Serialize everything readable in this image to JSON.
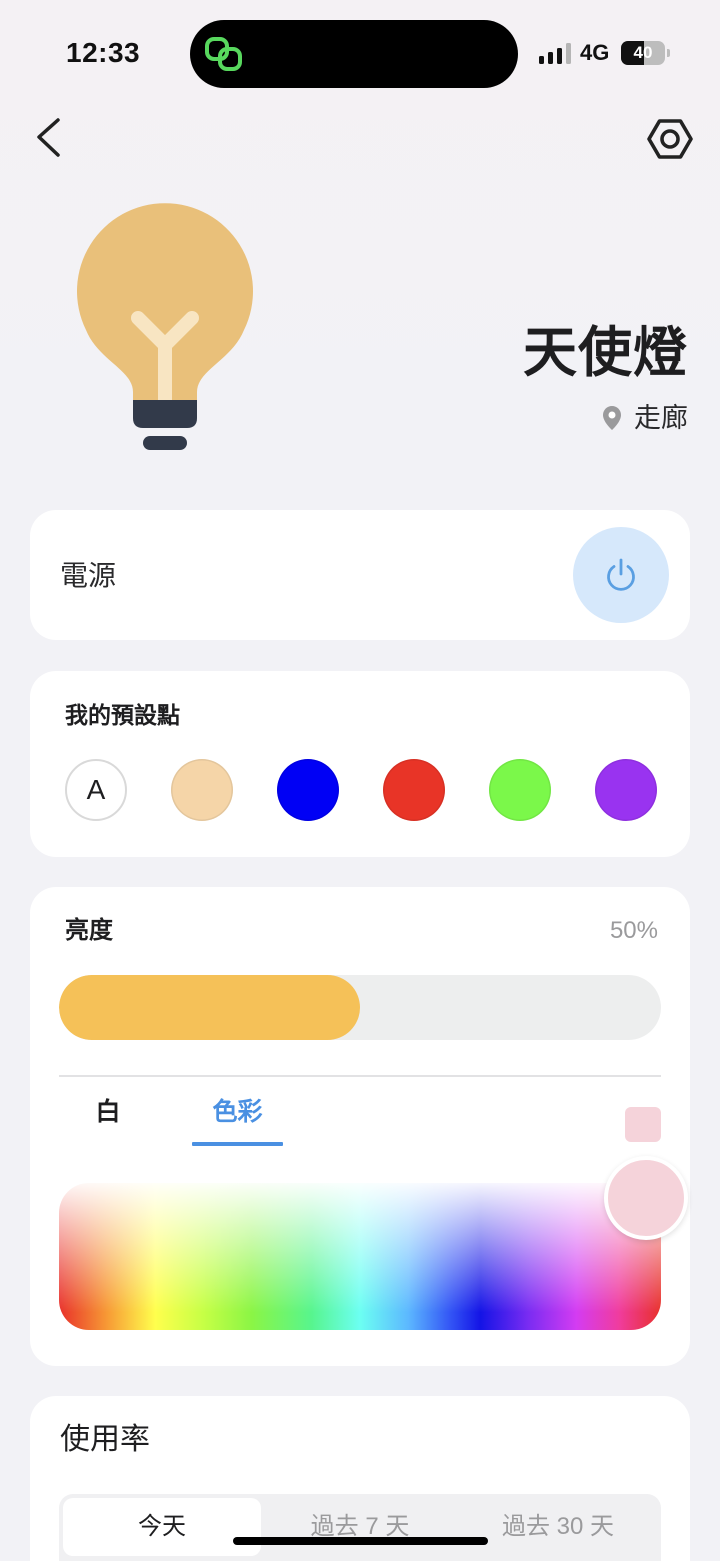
{
  "status_bar": {
    "time": "12:33",
    "network": "4G",
    "battery": "40",
    "island_icon": "link-activity-icon",
    "signal_icon": "cellular-signal-icon",
    "battery_icon": "battery-icon"
  },
  "header": {
    "back_icon": "chevron-left-icon",
    "settings_icon": "settings-hexagon-icon"
  },
  "device": {
    "name": "天使燈",
    "location": "走廊",
    "illustration": "lightbulb-icon",
    "location_icon": "location-pin-icon"
  },
  "power": {
    "label": "電源",
    "icon": "power-icon"
  },
  "presets": {
    "title": "我的預設點",
    "items": [
      {
        "label": "A",
        "color": "#FFFFFF"
      },
      {
        "color": "#F5D5A8"
      },
      {
        "color": "#0000F5"
      },
      {
        "color": "#E83427"
      },
      {
        "color": "#7BF84A"
      },
      {
        "color": "#9933F0"
      }
    ]
  },
  "brightness": {
    "label": "亮度",
    "value_text": "50%",
    "level": 0.5
  },
  "color_mode": {
    "tabs": [
      {
        "label": "白",
        "active": false
      },
      {
        "label": "色彩",
        "active": true
      }
    ],
    "selected_color": "#F5D3DA"
  },
  "usage": {
    "title": "使用率",
    "ranges": [
      {
        "label": "今天",
        "active": true
      },
      {
        "label": "過去 7 天",
        "active": false
      },
      {
        "label": "過去 30 天",
        "active": false
      }
    ]
  },
  "theme": {
    "accent": "#4A90E2",
    "brightness_fill": "#F5C158",
    "power_button_bg": "#D6E8FB",
    "background": "#F2F2F6"
  }
}
